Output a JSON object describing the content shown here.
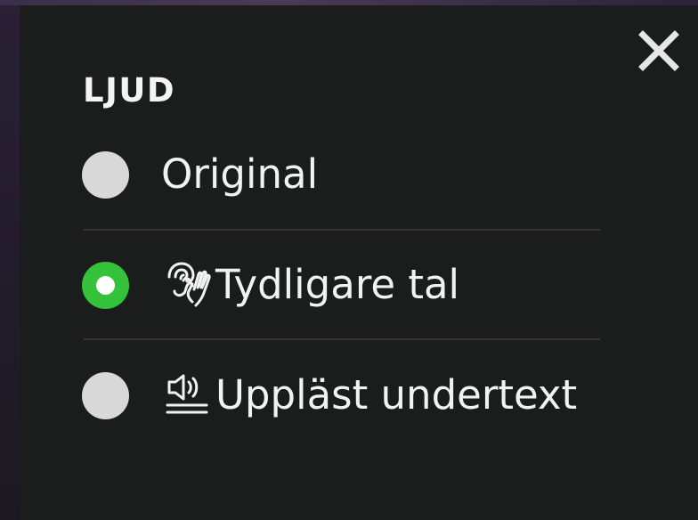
{
  "panel": {
    "heading": "LJUD",
    "close_icon": "close-icon"
  },
  "audio_options": [
    {
      "label": "Original",
      "selected": false,
      "icon": ""
    },
    {
      "label": "Tydligare tal",
      "selected": true,
      "icon": "ear-hand-icon"
    },
    {
      "label": "Uppläst undertext",
      "selected": false,
      "icon": "speaker-subtitles-icon"
    }
  ],
  "colors": {
    "panel_bg": "#1b1d1d",
    "radio_selected": "#33c23a",
    "radio_unselected": "#d8d8d8",
    "text": "#f2f2f2"
  }
}
